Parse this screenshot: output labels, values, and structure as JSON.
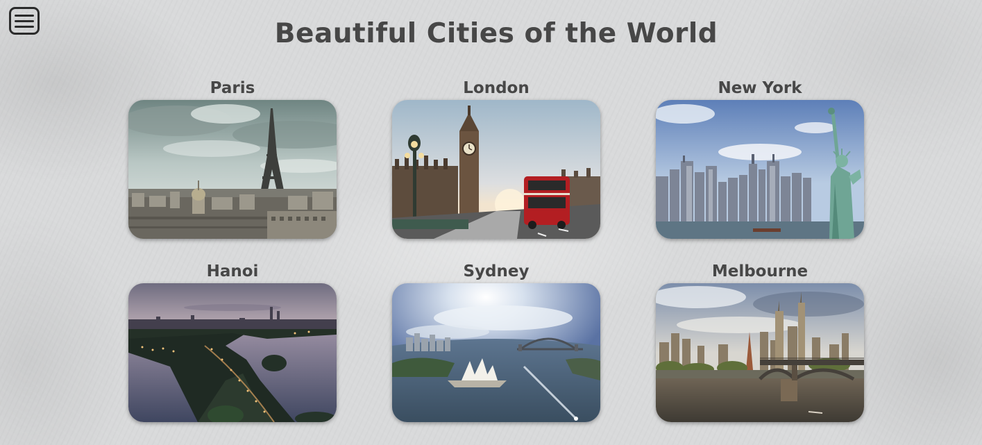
{
  "page": {
    "title": "Beautiful Cities of the World"
  },
  "menu": {
    "icon": "hamburger-menu-icon"
  },
  "cities": [
    {
      "name": "Paris"
    },
    {
      "name": "London"
    },
    {
      "name": "New York"
    },
    {
      "name": "Hanoi"
    },
    {
      "name": "Sydney"
    },
    {
      "name": "Melbourne"
    }
  ],
  "colors": {
    "text": "#474747",
    "background": "#d9dadb",
    "menu_icon": "#2b2b2b"
  }
}
